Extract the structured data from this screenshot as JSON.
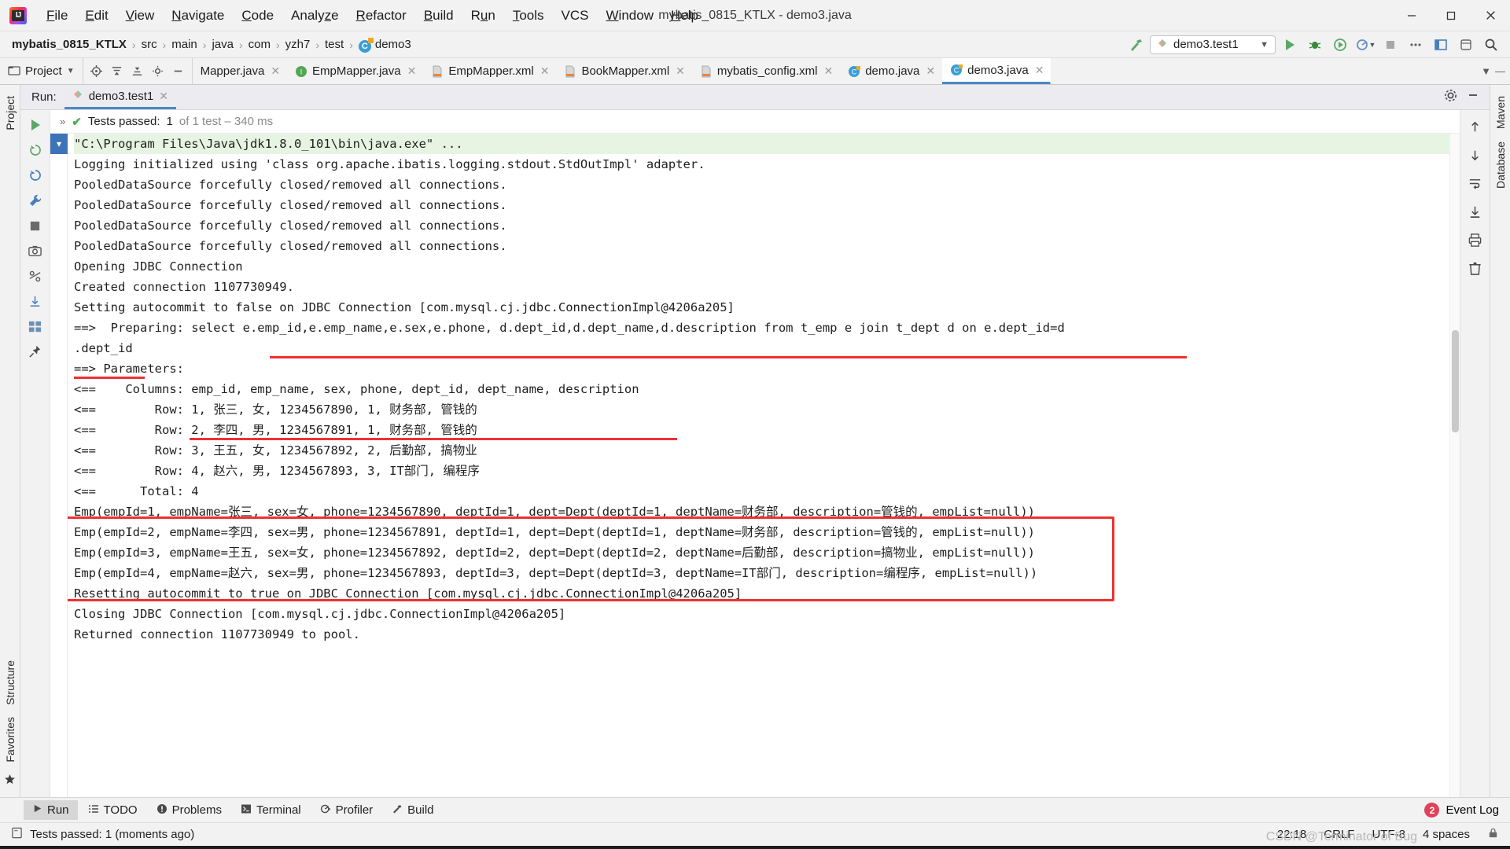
{
  "window": {
    "title": "mybatis_0815_KTLX - demo3.java",
    "minimize_label": "minimize-icon",
    "maximize_label": "maximize-icon",
    "close_label": "close-icon"
  },
  "menu": [
    {
      "label": "File"
    },
    {
      "label": "Edit"
    },
    {
      "label": "View"
    },
    {
      "label": "Navigate"
    },
    {
      "label": "Code"
    },
    {
      "label": "Analyze"
    },
    {
      "label": "Refactor"
    },
    {
      "label": "Build"
    },
    {
      "label": "Run"
    },
    {
      "label": "Tools"
    },
    {
      "label": "VCS"
    },
    {
      "label": "Window"
    },
    {
      "label": "Help"
    }
  ],
  "breadcrumb": {
    "items": [
      "mybatis_0815_KTLX",
      "src",
      "main",
      "java",
      "com",
      "yzh7",
      "test",
      "demo3"
    ],
    "separator": "›"
  },
  "toolbar": {
    "run_config": "demo3.test1",
    "build_icon": "hammer-icon",
    "run_icon": "run-icon",
    "debug_icon": "debug-icon",
    "run_coverage_icon": "run-with-coverage-icon",
    "profile_icon": "profile-icon",
    "stop_icon": "stop-icon",
    "search_icon": "search-icon",
    "layout_icon": "layout-icon",
    "dropdown_icon": "chevron-down-icon"
  },
  "project_button": {
    "label": "Project",
    "icon": "project-folder-icon",
    "dropdown": "chevron-down-icon"
  },
  "tool_icons": [
    {
      "name": "locate-icon"
    },
    {
      "name": "expand-all-icon"
    },
    {
      "name": "collapse-all-icon"
    },
    {
      "name": "settings-gear-icon"
    },
    {
      "name": "hide-icon"
    }
  ],
  "editor_tabs": [
    {
      "label": "Mapper.java",
      "icon": "java-class-icon",
      "icon_color": "#389fd6",
      "active": false,
      "truncated": true
    },
    {
      "label": "EmpMapper.java",
      "icon": "java-interface-icon",
      "icon_color": "#53a653",
      "active": false
    },
    {
      "label": "EmpMapper.xml",
      "icon": "xml-file-icon",
      "icon_color": "#e8853c",
      "active": false
    },
    {
      "label": "BookMapper.xml",
      "icon": "xml-file-icon",
      "icon_color": "#e8853c",
      "active": false
    },
    {
      "label": "mybatis_config.xml",
      "icon": "xml-file-icon",
      "icon_color": "#e8853c",
      "active": false
    },
    {
      "label": "demo.java",
      "icon": "java-class-icon",
      "icon_color": "#389fd6",
      "active": false
    },
    {
      "label": "demo3.java",
      "icon": "java-class-icon",
      "icon_color": "#389fd6",
      "active": true
    }
  ],
  "left_strip": [
    {
      "label": "Project"
    },
    {
      "label": "Structure"
    },
    {
      "label": "Favorites"
    }
  ],
  "right_strip": [
    {
      "label": "Maven"
    },
    {
      "label": "Database"
    }
  ],
  "run_window": {
    "label": "Run:",
    "tab": "demo3.test1",
    "tab_icon": "test-run-icon",
    "close_icon": "close-icon",
    "settings_icon": "gear-icon",
    "hide_icon": "hide-icon",
    "gutter_icons": [
      {
        "name": "rerun-icon"
      },
      {
        "name": "rerun-failed-tests-icon"
      },
      {
        "name": "toggle-auto-test-icon"
      },
      {
        "name": "wrench-icon"
      },
      {
        "name": "stop-icon"
      },
      {
        "name": "screenshot-icon"
      },
      {
        "name": "settings-icon"
      },
      {
        "name": "export-icon"
      },
      {
        "name": "layout-icon"
      },
      {
        "name": "pin-icon"
      }
    ],
    "right_icons": [
      {
        "name": "scroll-up-icon"
      },
      {
        "name": "scroll-down-icon"
      },
      {
        "name": "soft-wrap-icon"
      },
      {
        "name": "scroll-to-end-icon"
      },
      {
        "name": "print-icon"
      },
      {
        "name": "clear-all-icon"
      }
    ],
    "status": {
      "expand_icon": "chevron-right-icon",
      "check_icon": "check-icon",
      "passed_label": "Tests passed:",
      "passed_count": "1",
      "detail": "of 1 test – 340 ms"
    },
    "fold_marker": "collapse-chevron-icon"
  },
  "console": {
    "lines": [
      {
        "text": "\"C:\\Program Files\\Java\\jdk1.8.0_101\\bin\\java.exe\" ...",
        "cmd": true
      },
      {
        "text": "Logging initialized using 'class org.apache.ibatis.logging.stdout.StdOutImpl' adapter."
      },
      {
        "text": "PooledDataSource forcefully closed/removed all connections."
      },
      {
        "text": "PooledDataSource forcefully closed/removed all connections."
      },
      {
        "text": "PooledDataSource forcefully closed/removed all connections."
      },
      {
        "text": "PooledDataSource forcefully closed/removed all connections."
      },
      {
        "text": "Opening JDBC Connection"
      },
      {
        "text": "Created connection 1107730949."
      },
      {
        "text": "Setting autocommit to false on JDBC Connection [com.mysql.cj.jdbc.ConnectionImpl@4206a205]"
      },
      {
        "text": "==>  Preparing: select e.emp_id,e.emp_name,e.sex,e.phone, d.dept_id,d.dept_name,d.description from t_emp e join t_dept d on e.dept_id=d"
      },
      {
        "text": ".dept_id"
      },
      {
        "text": "==> Parameters:"
      },
      {
        "text": "<==    Columns: emp_id, emp_name, sex, phone, dept_id, dept_name, description"
      },
      {
        "text": "<==        Row: 1, 张三, 女, 1234567890, 1, 财务部, 管钱的"
      },
      {
        "text": "<==        Row: 2, 李四, 男, 1234567891, 1, 财务部, 管钱的"
      },
      {
        "text": "<==        Row: 3, 王五, 女, 1234567892, 2, 后勤部, 搞物业"
      },
      {
        "text": "<==        Row: 4, 赵六, 男, 1234567893, 3, IT部门, 编程序"
      },
      {
        "text": "<==      Total: 4"
      },
      {
        "text": "Emp(empId=1, empName=张三, sex=女, phone=1234567890, deptId=1, dept=Dept(deptId=1, deptName=财务部, description=管钱的, empList=null))"
      },
      {
        "text": "Emp(empId=2, empName=李四, sex=男, phone=1234567891, deptId=1, dept=Dept(deptId=1, deptName=财务部, description=管钱的, empList=null))"
      },
      {
        "text": "Emp(empId=3, empName=王五, sex=女, phone=1234567892, deptId=2, dept=Dept(deptId=2, deptName=后勤部, description=搞物业, empList=null))"
      },
      {
        "text": "Emp(empId=4, empName=赵六, sex=男, phone=1234567893, deptId=3, dept=Dept(deptId=3, deptName=IT部门, description=编程序, empList=null))"
      },
      {
        "text": "Resetting autocommit to true on JDBC Connection [com.mysql.cj.jdbc.ConnectionImpl@4206a205]"
      },
      {
        "text": "Closing JDBC Connection [com.mysql.cj.jdbc.ConnectionImpl@4206a205]"
      },
      {
        "text": "Returned connection 1107730949 to pool."
      }
    ],
    "annotation_color": "#f03030"
  },
  "bottom_tools": [
    {
      "label": "Run",
      "icon": "run-icon",
      "active": true
    },
    {
      "label": "TODO",
      "icon": "todo-list-icon",
      "active": false
    },
    {
      "label": "Problems",
      "icon": "problems-icon",
      "active": false
    },
    {
      "label": "Terminal",
      "icon": "terminal-icon",
      "active": false
    },
    {
      "label": "Profiler",
      "icon": "profiler-icon",
      "active": false
    },
    {
      "label": "Build",
      "icon": "hammer-icon",
      "active": false
    }
  ],
  "event_log": {
    "count": "2",
    "label": "Event Log"
  },
  "status_bar": {
    "message": "Tests passed: 1 (moments ago)",
    "message_icon": "console-icon",
    "time": "22:18",
    "line_separator": "CRLF",
    "encoding": "UTF-8",
    "indent": "4 spaces",
    "lock_icon": "lock-icon",
    "watermark": "CSDN @Terminator of Bug"
  }
}
